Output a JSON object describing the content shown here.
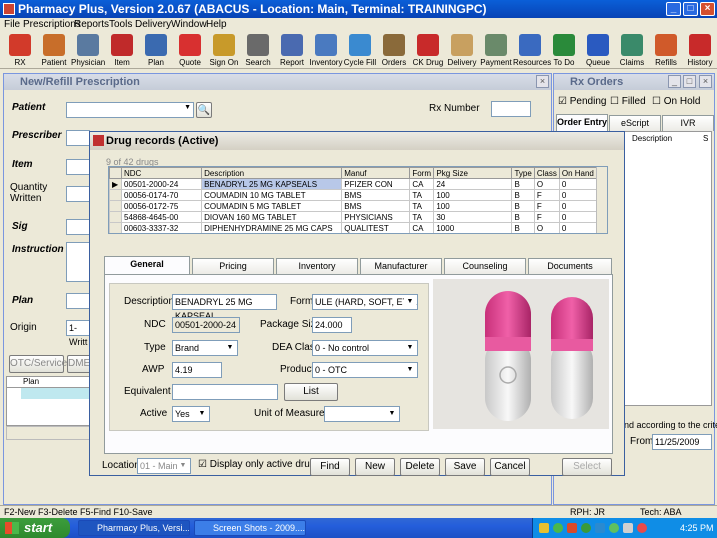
{
  "app": {
    "title": "Pharmacy Plus, Version 2.0.67 (ABACUS - Location: Main, Terminal: TRAININGPC)"
  },
  "menu": [
    "File",
    "Prescriptions",
    "Reports",
    "Tools",
    "Delivery",
    "Window",
    "Help"
  ],
  "toolbar": [
    {
      "label": "RX",
      "icon": "rx-icon",
      "color": "#d23a2a"
    },
    {
      "label": "Patient",
      "icon": "patient-icon",
      "color": "#c86e2a"
    },
    {
      "label": "Physician",
      "icon": "physician-icon",
      "color": "#5a7aa0"
    },
    {
      "label": "Item",
      "icon": "item-icon",
      "color": "#c02a2a"
    },
    {
      "label": "Plan",
      "icon": "plan-icon",
      "color": "#3a6ab0"
    },
    {
      "label": "Quote",
      "icon": "quote-icon",
      "color": "#d83030"
    },
    {
      "label": "Sign On",
      "icon": "lock-icon",
      "color": "#c89a2a"
    },
    {
      "label": "Search",
      "icon": "search-icon",
      "color": "#6a6a6a"
    },
    {
      "label": "Report",
      "icon": "report-icon",
      "color": "#4a6ab0"
    },
    {
      "label": "Inventory",
      "icon": "inventory-icon",
      "color": "#4a7ac0"
    },
    {
      "label": "Cycle Fill",
      "icon": "funnel-icon",
      "color": "#3a8ad0"
    },
    {
      "label": "Orders",
      "icon": "orders-icon",
      "color": "#8a6a3a"
    },
    {
      "label": "CK Drug",
      "icon": "check-icon",
      "color": "#c82a2a"
    },
    {
      "label": "Delivery",
      "icon": "delivery-icon",
      "color": "#c8a060"
    },
    {
      "label": "Payment",
      "icon": "payment-icon",
      "color": "#6a8a6a"
    },
    {
      "label": "Resources",
      "icon": "globe-icon",
      "color": "#3a6ac0"
    },
    {
      "label": "To Do",
      "icon": "todo-icon",
      "color": "#2a8a3a"
    },
    {
      "label": "Queue",
      "icon": "queue-icon",
      "color": "#2a5ac0"
    },
    {
      "label": "Claims",
      "icon": "claims-icon",
      "color": "#3a8a6a"
    },
    {
      "label": "Refills",
      "icon": "refills-icon",
      "color": "#d05a2a"
    },
    {
      "label": "History",
      "icon": "history-icon",
      "color": "#c82a2a"
    }
  ],
  "rxwin": {
    "title": "New/Refill Prescription",
    "patient": "Patient",
    "prescriber": "Prescriber",
    "item": "Item",
    "quantity": "Quantity",
    "written": "Written",
    "sig": "Sig",
    "instruction": "Instruction",
    "plan": "Plan",
    "origin": "Origin",
    "origin_value": "1-Writt",
    "rx_number": "Rx Number",
    "otc": "OTC/Service",
    "dme": "DME",
    "plan_col": "Plan",
    "status_keys": "F2-New  F3-Delete  F5-Find  F10-Save"
  },
  "orders": {
    "title": "Rx Orders",
    "pending": "Pending",
    "filled": "Filled",
    "onhold": "On Hold",
    "tabs": [
      "Order Entry",
      "eScript",
      "IVR"
    ],
    "desc_col": "Description",
    "s_col": "S",
    "criteria": "nd according to the criteria",
    "from_label": "From",
    "from_value": "11/25/2009",
    "rph": "RPH: JR",
    "tech": "Tech: ABA"
  },
  "dlg": {
    "title": "Drug records (Active)",
    "count": "9 of 42 drugs",
    "columns": [
      "NDC",
      "Description",
      "Manuf",
      "Form",
      "Pkg Size",
      "Type",
      "Class",
      "On Hand"
    ],
    "rows": [
      [
        "00501-2000-24",
        "BENADRYL 25 MG KAPSEALS",
        "PFIZER CON",
        "CA",
        "24",
        "B",
        "O",
        "0"
      ],
      [
        "00056-0174-70",
        "COUMADIN 10 MG TABLET",
        "BMS",
        "TA",
        "100",
        "B",
        "F",
        "0"
      ],
      [
        "00056-0172-75",
        "COUMADIN 5 MG TABLET",
        "BMS",
        "TA",
        "100",
        "B",
        "F",
        "0"
      ],
      [
        "54868-4645-00",
        "DIOVAN 160 MG TABLET",
        "PHYSICIANS",
        "TA",
        "30",
        "B",
        "F",
        "0"
      ],
      [
        "00603-3337-32",
        "DIPHENHYDRAMINE 25 MG CAPS",
        "QUALITEST",
        "CA",
        "1000",
        "B",
        "O",
        "0"
      ]
    ],
    "tabs": [
      "General",
      "Pricing",
      "Inventory",
      "Manufacturer",
      "Counseling",
      "Documents"
    ],
    "general": {
      "description_label": "Description",
      "description": "BENADRYL 25 MG KAPSEAL",
      "ndc_label": "NDC",
      "ndc": "00501-2000-24",
      "type_label": "Type",
      "type": "Brand",
      "awp_label": "AWP",
      "awp": "4.19",
      "equivalent_label": "Equivalent",
      "equivalent": "",
      "active_label": "Active",
      "active": "Yes",
      "form_label": "Form",
      "form": "ULE (HARD, SOFT, ETC.)",
      "pkg_label": "Package Size",
      "pkg": "24.000",
      "dea_label": "DEA Class",
      "dea": "0 - No control",
      "product_label": "Product",
      "product": "0 - OTC",
      "uom_label": "Unit of Measure",
      "uom": "",
      "list_btn": "List"
    },
    "location_label": "Location",
    "location": "01 - Main",
    "display_active": "Display only active drugs",
    "buttons": {
      "find": "Find",
      "new": "New",
      "delete": "Delete",
      "save": "Save",
      "cancel": "Cancel",
      "select": "Select"
    }
  },
  "taskbar": {
    "start": "start",
    "tasks": [
      "Pharmacy Plus, Versi...",
      "Screen Shots - 2009...."
    ],
    "time": "4:25 PM"
  }
}
